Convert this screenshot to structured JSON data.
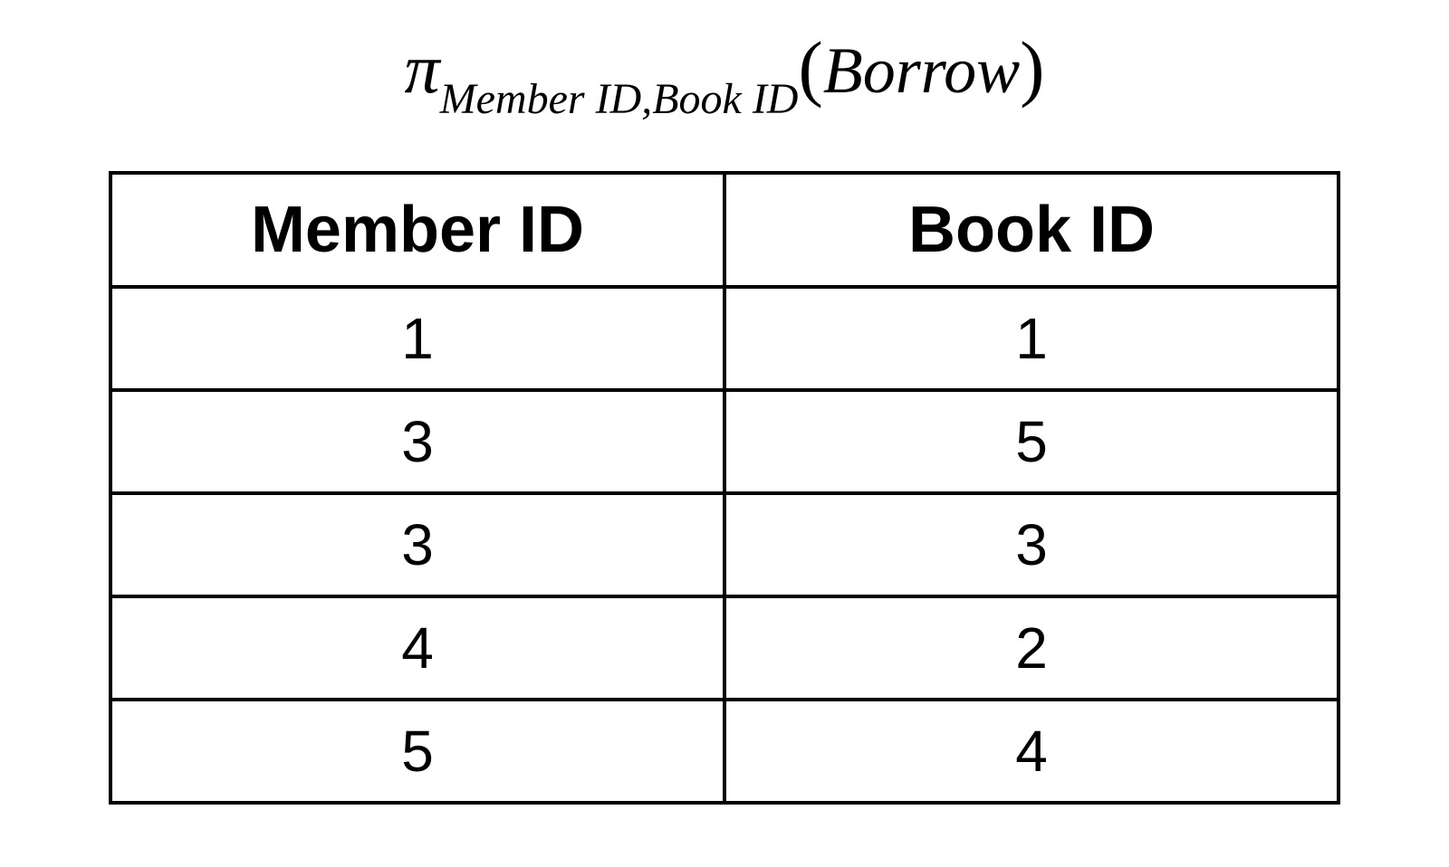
{
  "formula": {
    "pi": "π",
    "subscript": "Member ID,Book ID",
    "paren_open": "(",
    "relation": "Borrow",
    "paren_close": ")"
  },
  "chart_data": {
    "type": "table",
    "headers": [
      "Member ID",
      "Book ID"
    ],
    "rows": [
      [
        "1",
        "1"
      ],
      [
        "3",
        "5"
      ],
      [
        "3",
        "3"
      ],
      [
        "4",
        "2"
      ],
      [
        "5",
        "4"
      ]
    ]
  }
}
